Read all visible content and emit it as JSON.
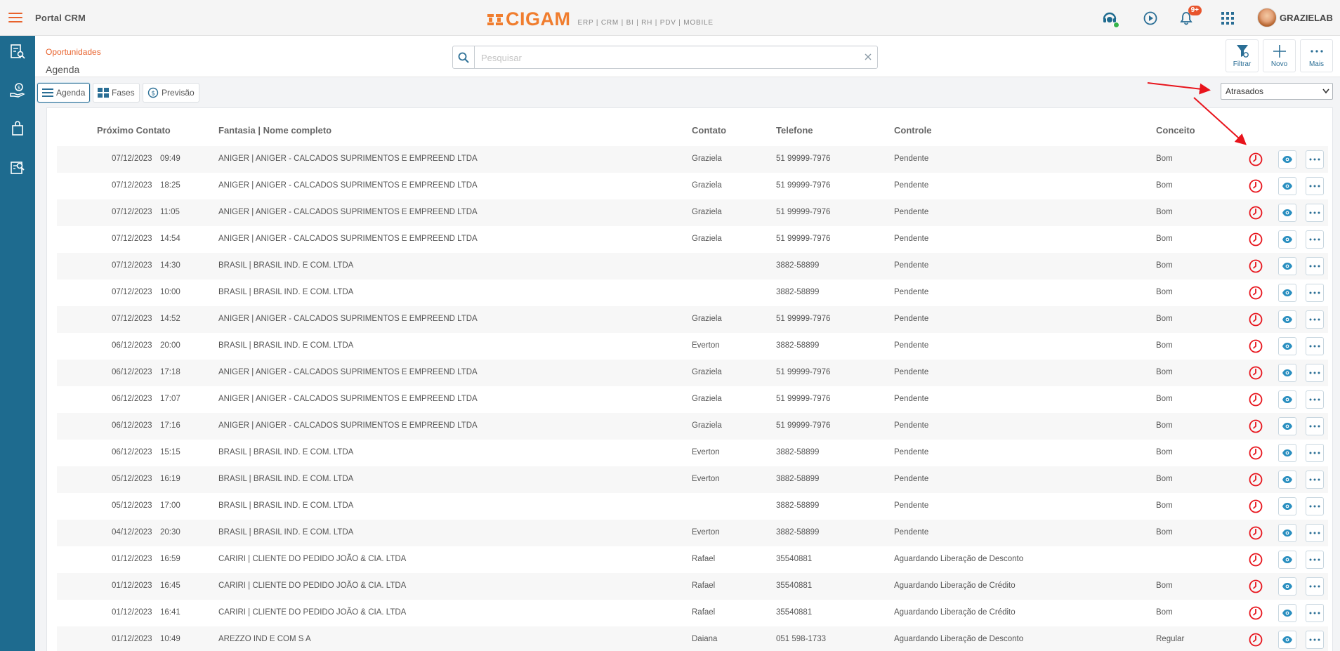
{
  "header": {
    "app_title": "Portal CRM",
    "logo_text": "CIGAM",
    "logo_tagline": "ERP | CRM | BI | RH | PDV | MOBILE",
    "notification_badge": "9+",
    "username": "GRAZIELAB"
  },
  "page": {
    "breadcrumb": "Oportunidades",
    "title": "Agenda"
  },
  "search": {
    "placeholder": "Pesquisar",
    "value": ""
  },
  "actions": {
    "filter_label": "Filtrar",
    "new_label": "Novo",
    "more_label": "Mais"
  },
  "views": {
    "agenda": "Agenda",
    "fases": "Fases",
    "previsao": "Previsão",
    "selected": "agenda"
  },
  "filter_select": {
    "selected": "Atrasados"
  },
  "table": {
    "columns": {
      "next_contact": "Próximo Contato",
      "name": "Fantasia | Nome completo",
      "contact": "Contato",
      "phone": "Telefone",
      "control": "Controle",
      "concept": "Conceito"
    },
    "rows": [
      {
        "date": "07/12/2023",
        "time": "09:49",
        "name": "ANIGER | ANIGER - CALCADOS SUPRIMENTOS E EMPREEND LTDA",
        "contact": "Graziela",
        "phone": "51 99999-7976",
        "control": "Pendente",
        "concept": "Bom"
      },
      {
        "date": "07/12/2023",
        "time": "18:25",
        "name": "ANIGER | ANIGER - CALCADOS SUPRIMENTOS E EMPREEND LTDA",
        "contact": "Graziela",
        "phone": "51 99999-7976",
        "control": "Pendente",
        "concept": "Bom"
      },
      {
        "date": "07/12/2023",
        "time": "11:05",
        "name": "ANIGER | ANIGER - CALCADOS SUPRIMENTOS E EMPREEND LTDA",
        "contact": "Graziela",
        "phone": "51 99999-7976",
        "control": "Pendente",
        "concept": "Bom"
      },
      {
        "date": "07/12/2023",
        "time": "14:54",
        "name": "ANIGER | ANIGER - CALCADOS SUPRIMENTOS E EMPREEND LTDA",
        "contact": "Graziela",
        "phone": "51 99999-7976",
        "control": "Pendente",
        "concept": "Bom"
      },
      {
        "date": "07/12/2023",
        "time": "14:30",
        "name": "BRASIL | BRASIL IND. E COM. LTDA",
        "contact": "",
        "phone": "3882-58899",
        "control": "Pendente",
        "concept": "Bom"
      },
      {
        "date": "07/12/2023",
        "time": "10:00",
        "name": "BRASIL | BRASIL IND. E COM. LTDA",
        "contact": "",
        "phone": "3882-58899",
        "control": "Pendente",
        "concept": "Bom"
      },
      {
        "date": "07/12/2023",
        "time": "14:52",
        "name": "ANIGER | ANIGER - CALCADOS SUPRIMENTOS E EMPREEND LTDA",
        "contact": "Graziela",
        "phone": "51 99999-7976",
        "control": "Pendente",
        "concept": "Bom"
      },
      {
        "date": "06/12/2023",
        "time": "20:00",
        "name": "BRASIL | BRASIL IND. E COM. LTDA",
        "contact": "Everton",
        "phone": "3882-58899",
        "control": "Pendente",
        "concept": "Bom"
      },
      {
        "date": "06/12/2023",
        "time": "17:18",
        "name": "ANIGER | ANIGER - CALCADOS SUPRIMENTOS E EMPREEND LTDA",
        "contact": "Graziela",
        "phone": "51 99999-7976",
        "control": "Pendente",
        "concept": "Bom"
      },
      {
        "date": "06/12/2023",
        "time": "17:07",
        "name": "ANIGER | ANIGER - CALCADOS SUPRIMENTOS E EMPREEND LTDA",
        "contact": "Graziela",
        "phone": "51 99999-7976",
        "control": "Pendente",
        "concept": "Bom"
      },
      {
        "date": "06/12/2023",
        "time": "17:16",
        "name": "ANIGER | ANIGER - CALCADOS SUPRIMENTOS E EMPREEND LTDA",
        "contact": "Graziela",
        "phone": "51 99999-7976",
        "control": "Pendente",
        "concept": "Bom"
      },
      {
        "date": "06/12/2023",
        "time": "15:15",
        "name": "BRASIL | BRASIL IND. E COM. LTDA",
        "contact": "Everton",
        "phone": "3882-58899",
        "control": "Pendente",
        "concept": "Bom"
      },
      {
        "date": "05/12/2023",
        "time": "16:19",
        "name": "BRASIL | BRASIL IND. E COM. LTDA",
        "contact": "Everton",
        "phone": "3882-58899",
        "control": "Pendente",
        "concept": "Bom"
      },
      {
        "date": "05/12/2023",
        "time": "17:00",
        "name": "BRASIL | BRASIL IND. E COM. LTDA",
        "contact": "",
        "phone": "3882-58899",
        "control": "Pendente",
        "concept": "Bom"
      },
      {
        "date": "04/12/2023",
        "time": "20:30",
        "name": "BRASIL | BRASIL IND. E COM. LTDA",
        "contact": "Everton",
        "phone": "3882-58899",
        "control": "Pendente",
        "concept": "Bom"
      },
      {
        "date": "01/12/2023",
        "time": "16:59",
        "name": "CARIRI | CLIENTE DO PEDIDO JOÃO & CIA. LTDA",
        "contact": "Rafael",
        "phone": "35540881",
        "control": "Aguardando Liberação de Desconto",
        "concept": ""
      },
      {
        "date": "01/12/2023",
        "time": "16:45",
        "name": "CARIRI | CLIENTE DO PEDIDO JOÃO & CIA. LTDA",
        "contact": "Rafael",
        "phone": "35540881",
        "control": "Aguardando Liberação de Crédito",
        "concept": "Bom"
      },
      {
        "date": "01/12/2023",
        "time": "16:41",
        "name": "CARIRI | CLIENTE DO PEDIDO JOÃO & CIA. LTDA",
        "contact": "Rafael",
        "phone": "35540881",
        "control": "Aguardando Liberação de Crédito",
        "concept": "Bom"
      },
      {
        "date": "01/12/2023",
        "time": "10:49",
        "name": "AREZZO IND E COM S A",
        "contact": "Daiana",
        "phone": "051 598-1733",
        "control": "Aguardando Liberação de Desconto",
        "concept": "Regular"
      }
    ]
  },
  "icons": {
    "menu": "hamburger-icon",
    "support": "headset-icon",
    "video": "play-circle-icon",
    "notifications": "bell-icon",
    "apps": "grid-apps-icon",
    "row_status": "clock-icon",
    "row_view": "eye-icon",
    "row_more": "ellipsis-icon"
  },
  "colors": {
    "brand_orange": "#f07d2e",
    "sidebar_blue": "#1e6b8f",
    "overdue_red": "#e8141c",
    "action_blue": "#2a8fc0"
  }
}
